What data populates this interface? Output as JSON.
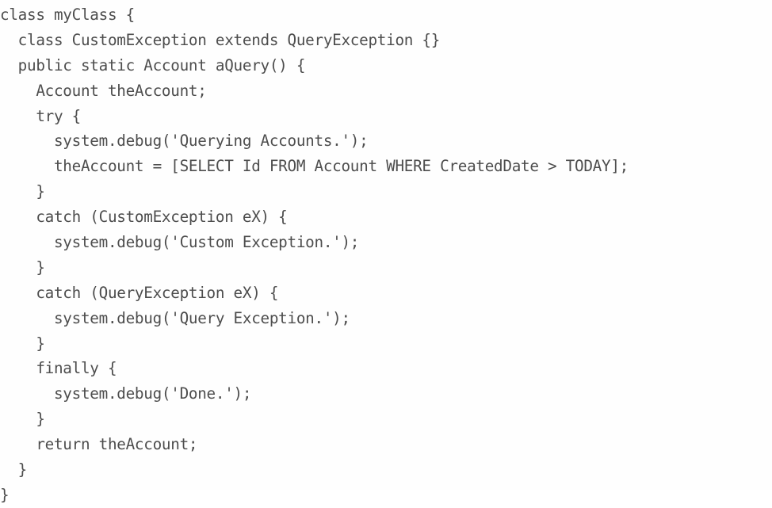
{
  "document": {
    "kind": "code-listing",
    "language": "Apex",
    "background_color": "#fefefe",
    "text_color": "#4d4d4d",
    "indent_unit": "  ",
    "line_count": 19
  },
  "code": {
    "lines": [
      "class myClass {",
      "  class CustomException extends QueryException {}",
      "  public static Account aQuery() {",
      "    Account theAccount;",
      "    try {",
      "      system.debug('Querying Accounts.');",
      "      theAccount = [SELECT Id FROM Account WHERE CreatedDate > TODAY];",
      "    }",
      "    catch (CustomException eX) {",
      "      system.debug('Custom Exception.');",
      "    }",
      "    catch (QueryException eX) {",
      "      system.debug('Query Exception.');",
      "    }",
      "    finally {",
      "      system.debug('Done.');",
      "    }",
      "    return theAccount;",
      "  }",
      "}"
    ]
  }
}
